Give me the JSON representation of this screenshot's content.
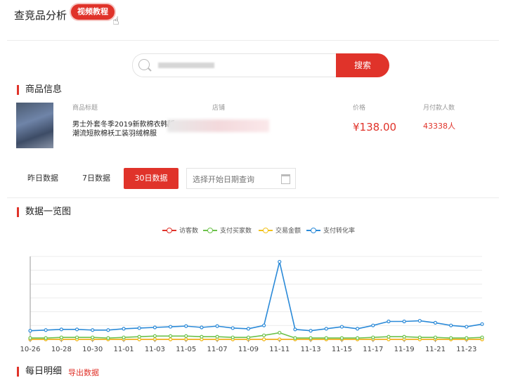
{
  "header": {
    "title": "查竞品分析",
    "video_badge": "视频教程"
  },
  "search": {
    "placeholder": "",
    "button_label": "搜索"
  },
  "product_section": {
    "title": "商品信息",
    "columns": [
      "商品标题",
      "店铺",
      "价格",
      "月付款人数"
    ],
    "product_title": "男士外套冬季2019新款棉衣韩版潮流短款棉袄工装羽绒棉服",
    "price": "¥138.00",
    "buyers": "43338人"
  },
  "date_tabs": [
    "昨日数据",
    "7日数据",
    "30日数据"
  ],
  "active_tab": "30日数据",
  "date_picker": {
    "placeholder": "选择开始日期查询"
  },
  "chart_section": {
    "title": "数据一览图"
  },
  "colors": {
    "accent": "#e0332a",
    "visitors": "#e0332a",
    "buyers": "#6cc24a",
    "amount": "#f2c21b",
    "conversion": "#2b8ad8"
  },
  "chart_data": {
    "type": "line",
    "x": [
      "10-26",
      "10-27",
      "10-28",
      "10-29",
      "10-30",
      "10-31",
      "11-01",
      "11-02",
      "11-03",
      "11-04",
      "11-05",
      "11-06",
      "11-07",
      "11-08",
      "11-09",
      "11-10",
      "11-11",
      "11-12",
      "11-13",
      "11-14",
      "11-15",
      "11-16",
      "11-17",
      "11-18",
      "11-19",
      "11-20",
      "11-21",
      "11-22",
      "11-23",
      "11-24"
    ],
    "xticks": [
      "10-26",
      "10-28",
      "10-30",
      "11-01",
      "11-03",
      "11-05",
      "11-07",
      "11-09",
      "11-11",
      "11-13",
      "11-15",
      "11-17",
      "11-19",
      "11-21",
      "11-23"
    ],
    "series": [
      {
        "name": "访客数",
        "values": [
          0,
          0,
          0,
          0,
          0,
          0,
          0,
          0,
          0,
          0,
          0,
          0,
          0,
          0,
          0,
          0,
          0,
          0,
          0,
          0,
          0,
          0,
          0,
          0,
          0,
          0,
          0,
          0,
          0,
          0
        ]
      },
      {
        "name": "支付买家数",
        "values": [
          2,
          2,
          3,
          3,
          3,
          2,
          3,
          4,
          5,
          5,
          5,
          4,
          4,
          3,
          3,
          6,
          10,
          2,
          2,
          2,
          2,
          2,
          3,
          4,
          4,
          3,
          3,
          2,
          2,
          3
        ]
      },
      {
        "name": "交易金额",
        "values": [
          0,
          0,
          0,
          0,
          0,
          0,
          0,
          0,
          0,
          0,
          0,
          0,
          0,
          0,
          0,
          0,
          0,
          0,
          0,
          0,
          0,
          0,
          0,
          0,
          0,
          0,
          0,
          0,
          0,
          0
        ]
      },
      {
        "name": "支付转化率",
        "values": [
          13,
          14,
          15,
          15,
          14,
          14,
          16,
          17,
          18,
          19,
          20,
          18,
          20,
          17,
          16,
          21,
          117,
          15,
          13,
          16,
          19,
          16,
          21,
          27,
          27,
          28,
          25,
          21,
          19,
          23
        ]
      }
    ],
    "ylim": [
      0,
      125
    ],
    "legend_position": "top-center",
    "grid": true
  },
  "footer": {
    "title": "每日明细",
    "export_link": "导出数据"
  }
}
